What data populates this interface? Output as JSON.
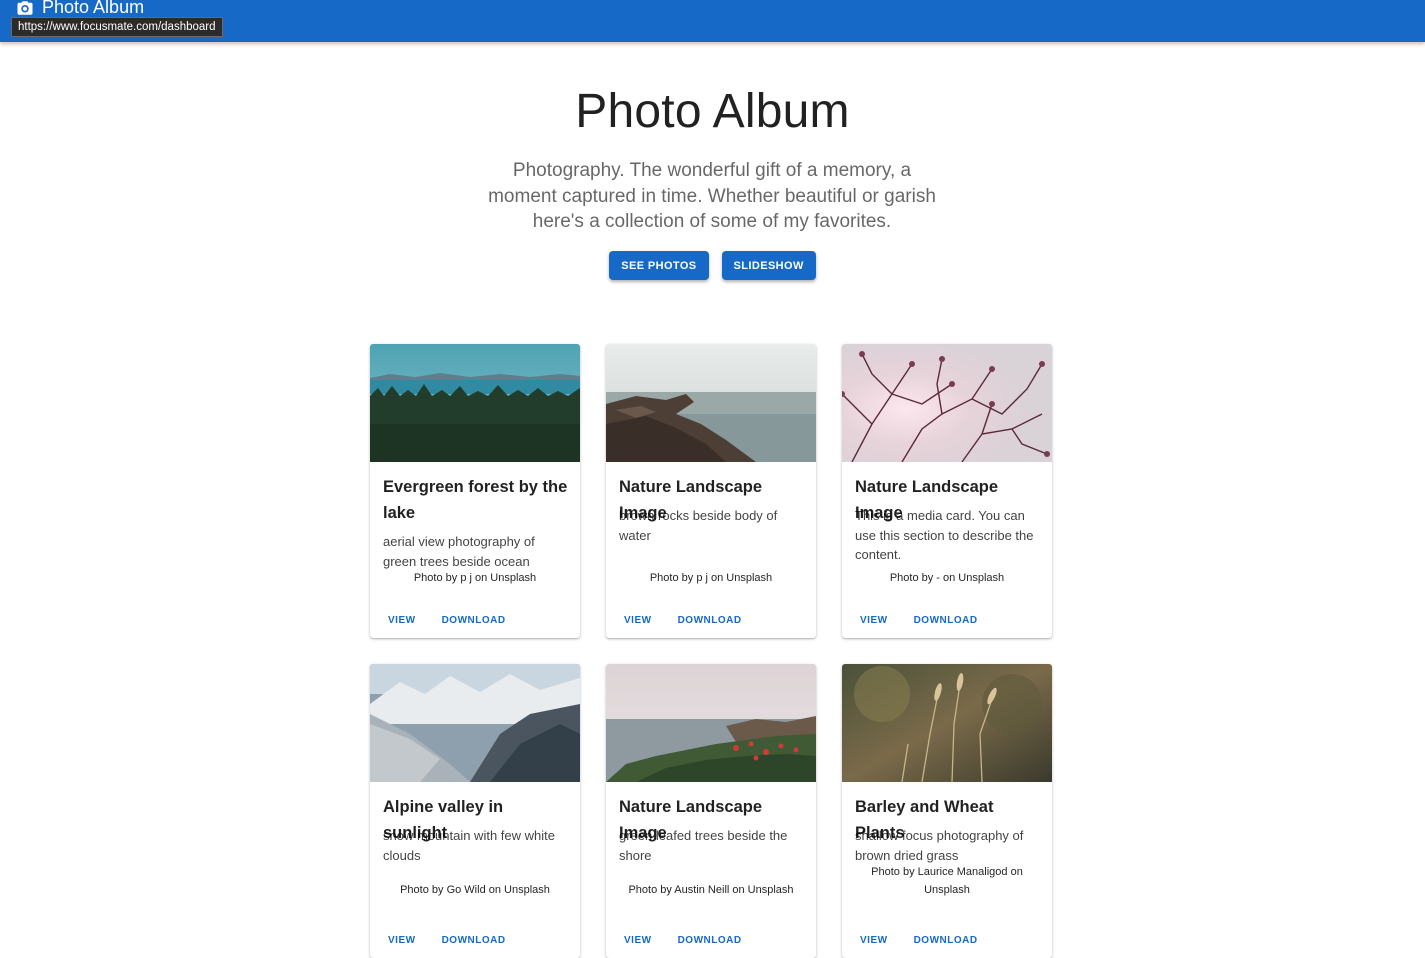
{
  "appbar": {
    "title": "Photo Album",
    "icon": "camera-icon",
    "url_tooltip": "https://www.focusmate.com/dashboard",
    "color": "#1769c7"
  },
  "hero": {
    "title": "Photo Album",
    "subtitle": "Photography. The wonderful gift of a memory, a moment captured in time. Whether beautiful or garish here's a collection of some of my favorites.",
    "buttons": [
      "SEE PHOTOS",
      "SLIDESHOW"
    ]
  },
  "cards": [
    {
      "title": "Evergreen forest by the lake",
      "description": "aerial view photography of green trees beside ocean",
      "credit": "Photo by p j on Unsplash",
      "actions": [
        "VIEW",
        "DOWNLOAD"
      ],
      "image_subject": "evergreen forest with lake and distant mountains"
    },
    {
      "title": "Nature Landscape Image",
      "description": "brown rocks beside body of water",
      "credit": "Photo by p j on Unsplash",
      "actions": [
        "VIEW",
        "DOWNLOAD"
      ],
      "image_subject": "rocky shore beside calm sea"
    },
    {
      "title": "Nature Landscape Image",
      "description": "This is a media card. You can use this section to describe the content.",
      "credit": "Photo by - on Unsplash",
      "actions": [
        "VIEW",
        "DOWNLOAD"
      ],
      "image_subject": "silhouetted blossom branches against pale sky"
    },
    {
      "title": "Alpine valley in sunlight",
      "description": "snow mountain with few white clouds",
      "credit": "Photo by Go Wild on Unsplash",
      "actions": [
        "VIEW",
        "DOWNLOAD"
      ],
      "image_subject": "snowy mountain valley"
    },
    {
      "title": "Nature Landscape Image",
      "description": "green leafed trees beside the shore",
      "credit": "Photo by Austin Neill on Unsplash",
      "actions": [
        "VIEW",
        "DOWNLOAD"
      ],
      "image_subject": "coastal shrubs with red flowers by the sea"
    },
    {
      "title": "Barley and Wheat Plants",
      "description": "shallow focus photography of brown dried grass",
      "credit": "Photo by Laurice Manaligod on Unsplash",
      "actions": [
        "VIEW",
        "DOWNLOAD"
      ],
      "image_subject": "dried wheat grass in soft focus"
    }
  ]
}
